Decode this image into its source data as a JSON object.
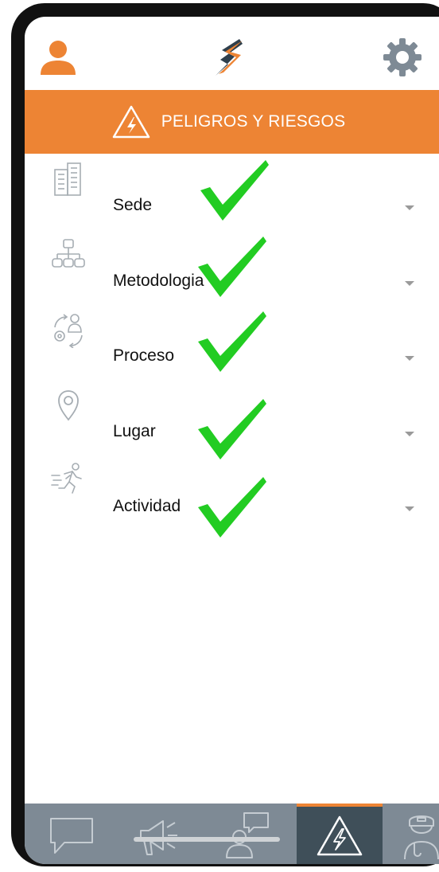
{
  "header": {
    "user_icon": "user-icon",
    "logo_icon": "brand-logo",
    "settings_icon": "gear-icon"
  },
  "banner": {
    "title": "PELIGROS Y RIESGOS",
    "icon": "warning-triangle-icon",
    "color": "#ED8434"
  },
  "form": {
    "fields": [
      {
        "label": "Sede",
        "icon": "building-icon"
      },
      {
        "label": "Metodologia",
        "icon": "hierarchy-icon"
      },
      {
        "label": "Proceso",
        "icon": "process-cycle-icon"
      },
      {
        "label": "Lugar",
        "icon": "location-pin-icon"
      },
      {
        "label": "Actividad",
        "icon": "running-person-icon"
      }
    ],
    "checkmark_color": "#22cc22"
  },
  "tabbar": {
    "tabs": [
      {
        "icon": "chat-icon",
        "active": false
      },
      {
        "icon": "megaphone-icon",
        "active": false
      },
      {
        "icon": "person-message-icon",
        "active": false
      },
      {
        "icon": "warning-triangle-icon",
        "active": true
      },
      {
        "icon": "doctor-icon",
        "active": false
      }
    ],
    "active_color": "#3f4f59",
    "accent_color": "#ED8434"
  }
}
